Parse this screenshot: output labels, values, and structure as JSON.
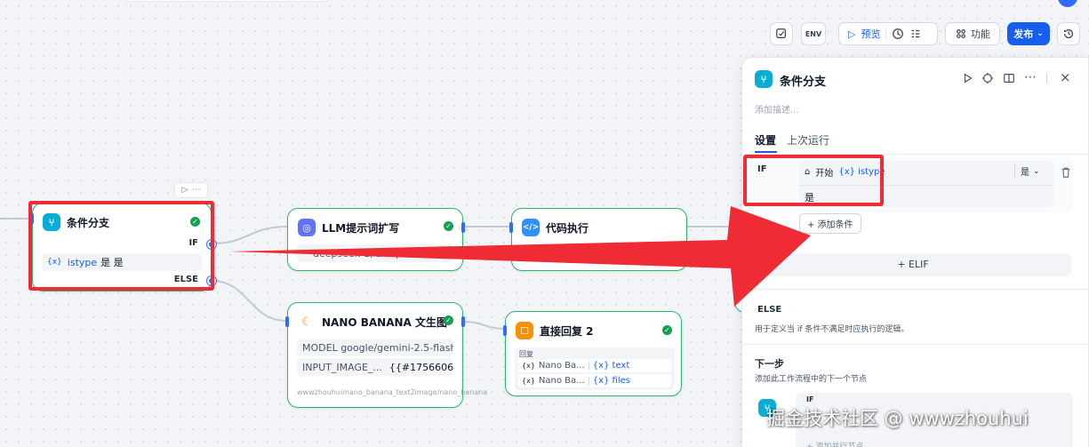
{
  "toolbar": {
    "preview_label": "预览",
    "features_label": "功能",
    "publish_label": "发布",
    "env_label": "ENV"
  },
  "canvas": {
    "if_node": {
      "title": "条件分支",
      "if_label": "IF",
      "else_label": "ELSE",
      "condition_var": "{x}",
      "condition_name": "istype",
      "condition_text": "是 是"
    },
    "llm_node": {
      "title": "LLM提示词扩写",
      "model_text": "deepseek-1, Deepse"
    },
    "code_node": {
      "title": "代码执行"
    },
    "nano_node": {
      "title": "NANO BANANA 文生图",
      "model_row": "MODEL google/gemini-2.5-flash-i...",
      "input_label": "INPUT_IMAGE_...",
      "input_value": "{{#1756606966...",
      "footer": "wwwzhouhui/nano_banana_text2image/nano_banana"
    },
    "reply_node": {
      "title": "直接回复 2",
      "section_label": "回复",
      "rows": [
        {
          "var_icon": "{x}",
          "node": "Nano Ba...",
          "var": "{x} text"
        },
        {
          "var_icon": "{x}",
          "node": "Nano Ba...",
          "var": "{x} files"
        }
      ]
    }
  },
  "panel": {
    "title": "条件分支",
    "description_placeholder": "添加描述...",
    "tabs": [
      "设置",
      "上次运行"
    ],
    "if_label": "IF",
    "condition": {
      "source": "开始",
      "var": "{x} istype",
      "operator": "是",
      "value": "是"
    },
    "add_condition": "+ 添加条件",
    "elif_button": "+ ELIF",
    "else_title": "ELSE",
    "else_desc": "用于定义当 if 条件不满足时应执行的逻辑。",
    "next_title": "下一步",
    "next_desc": "添加此工作流程中的下一个节点",
    "next_branch_label": "IF",
    "add_parallel": "+ 添加并行节点"
  },
  "watermark": "掘金技术社区 @ wwwzhouhui",
  "colors": {
    "accent": "#155eef",
    "success": "#12a150",
    "annotation_red": "#ef2b35"
  }
}
